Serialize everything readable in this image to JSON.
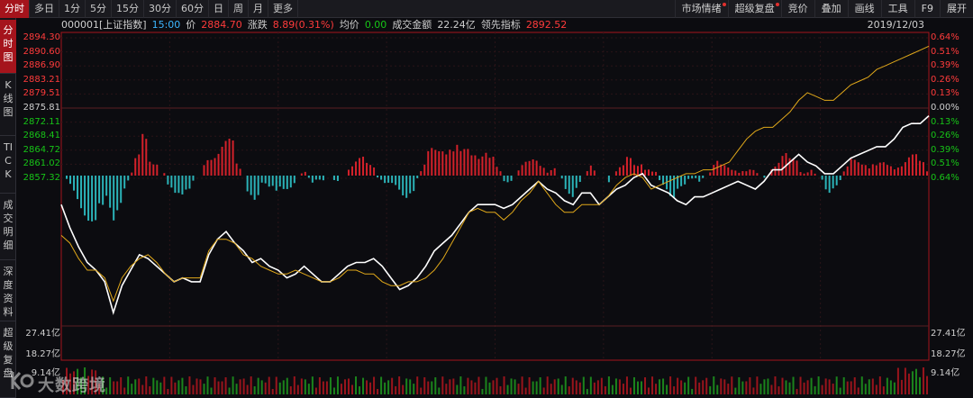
{
  "period_tabs": [
    "分时",
    "多日",
    "1分",
    "5分",
    "15分",
    "30分",
    "60分",
    "日",
    "周",
    "月",
    "更多"
  ],
  "active_period": 0,
  "tools": [
    {
      "label": "市场情绪",
      "dot": true
    },
    {
      "label": "超级复盘",
      "dot": true
    },
    {
      "label": "竞价",
      "dot": false
    },
    {
      "label": "叠加",
      "dot": false
    },
    {
      "label": "画线",
      "dot": false
    },
    {
      "label": "工具",
      "dot": false
    },
    {
      "label": "F9",
      "dot": false
    },
    {
      "label": "展开",
      "dot": false
    }
  ],
  "side_tabs": [
    {
      "label": "分时图",
      "active": true
    },
    {
      "label": "K线图",
      "active": false
    },
    {
      "label": "TICK",
      "active": false
    },
    {
      "label": "成交明细",
      "active": false
    },
    {
      "label": "深度资料",
      "active": false
    },
    {
      "label": "超级复盘",
      "active": false
    }
  ],
  "info": {
    "code": "000001[上证指数]",
    "time": "15:00",
    "price_label": "价",
    "price": "2884.70",
    "change_label": "涨跌",
    "change": "8.89(0.31%)",
    "avg_label": "均价",
    "avg": "0.00",
    "turnover_label": "成交金额",
    "turnover": "22.24亿",
    "lead_label": "领先指标",
    "lead": "2892.52",
    "date": "2019/12/03"
  },
  "price_axis": [
    "2894.30",
    "2890.60",
    "2886.90",
    "2883.21",
    "2879.51",
    "2875.81",
    "2872.11",
    "2868.41",
    "2864.72",
    "2861.02",
    "2857.32"
  ],
  "pct_axis": [
    "0.64%",
    "0.51%",
    "0.39%",
    "0.26%",
    "0.13%",
    "0.00%",
    "0.13%",
    "0.26%",
    "0.39%",
    "0.51%",
    "0.64%"
  ],
  "volume_axis": [
    "27.41亿",
    "18.27亿",
    "9.14亿"
  ],
  "watermark": "大数跨境",
  "colors": {
    "up": "#ff3b3b",
    "down": "#17c417",
    "price_line": "#ffffff",
    "lead_line": "#e0a81a",
    "bar_up": "#d3212a",
    "bar_down": "#2bb3b8",
    "active_tab": "#a5141c"
  },
  "chart_data": {
    "type": "line",
    "x_range": [
      "09:30",
      "15:00"
    ],
    "ylim": [
      2857.32,
      2894.3
    ],
    "base": 2875.81,
    "series": [
      {
        "key": "price",
        "values": [
          2872.0,
          2869.0,
          2866.5,
          2864.5,
          2863.5,
          2862.0,
          2858.0,
          2861.5,
          2863.5,
          2865.5,
          2865.0,
          2864.0,
          2863.0,
          2862.0,
          2862.5,
          2862.0,
          2862.0,
          2865.5,
          2867.5,
          2868.5,
          2867.0,
          2866.0,
          2864.5,
          2865.0,
          2864.0,
          2863.5,
          2862.5,
          2863.0,
          2864.0,
          2863.0,
          2862.0,
          2862.0,
          2863.0,
          2864.0,
          2864.5,
          2864.5,
          2865.0,
          2864.0,
          2862.5,
          2861.0,
          2861.5,
          2862.5,
          2864.0,
          2866.0,
          2867.0,
          2868.0,
          2869.5,
          2871.0,
          2872.0,
          2872.0,
          2872.0,
          2871.5,
          2872.0,
          2873.0,
          2874.0,
          2875.0,
          2874.0,
          2873.5,
          2872.5,
          2872.0,
          2873.5,
          2873.5,
          2872.0,
          2873.0,
          2874.0,
          2874.5,
          2875.5,
          2876.0,
          2874.5,
          2874.0,
          2873.5,
          2872.5,
          2872.0,
          2873.0,
          2873.0,
          2873.5,
          2874.0,
          2874.5,
          2875.0,
          2874.5,
          2874.0,
          2875.0,
          2876.5,
          2876.5,
          2877.5,
          2878.5,
          2877.5,
          2877.0,
          2876.0,
          2876.0,
          2877.0,
          2878.0,
          2878.5,
          2879.0,
          2879.5,
          2879.5,
          2880.5,
          2882.0,
          2882.5,
          2882.5,
          2883.5
        ],
        "name": ""
      },
      {
        "key": "lead",
        "values": [
          2868.0,
          2867.0,
          2865.0,
          2863.5,
          2863.5,
          2862.5,
          2859.5,
          2862.5,
          2864.0,
          2865.0,
          2865.5,
          2864.5,
          2863.0,
          2862.0,
          2862.5,
          2862.5,
          2862.5,
          2866.0,
          2867.5,
          2867.5,
          2867.0,
          2865.5,
          2865.0,
          2864.0,
          2863.5,
          2863.0,
          2863.0,
          2863.5,
          2863.0,
          2862.5,
          2862.0,
          2862.0,
          2862.5,
          2863.5,
          2863.5,
          2863.0,
          2863.0,
          2862.0,
          2861.5,
          2861.5,
          2862.0,
          2862.0,
          2862.5,
          2863.5,
          2865.0,
          2867.0,
          2869.0,
          2871.0,
          2871.5,
          2871.0,
          2871.0,
          2870.0,
          2871.0,
          2872.5,
          2873.5,
          2875.0,
          2873.5,
          2872.0,
          2871.0,
          2871.0,
          2872.0,
          2872.0,
          2872.0,
          2873.0,
          2874.5,
          2875.5,
          2876.0,
          2875.5,
          2874.0,
          2874.5,
          2875.0,
          2875.5,
          2876.0,
          2876.0,
          2876.5,
          2876.5,
          2877.0,
          2877.5,
          2879.0,
          2880.5,
          2881.5,
          2882.0,
          2882.0,
          2883.0,
          2884.0,
          2885.5,
          2886.5,
          2886.0,
          2885.5,
          2885.5,
          2886.5,
          2887.5,
          2888.0,
          2888.5,
          2889.5,
          2890.0,
          2890.5,
          2891.0,
          2891.5,
          2892.0,
          2892.52
        ],
        "name": ""
      }
    ]
  }
}
